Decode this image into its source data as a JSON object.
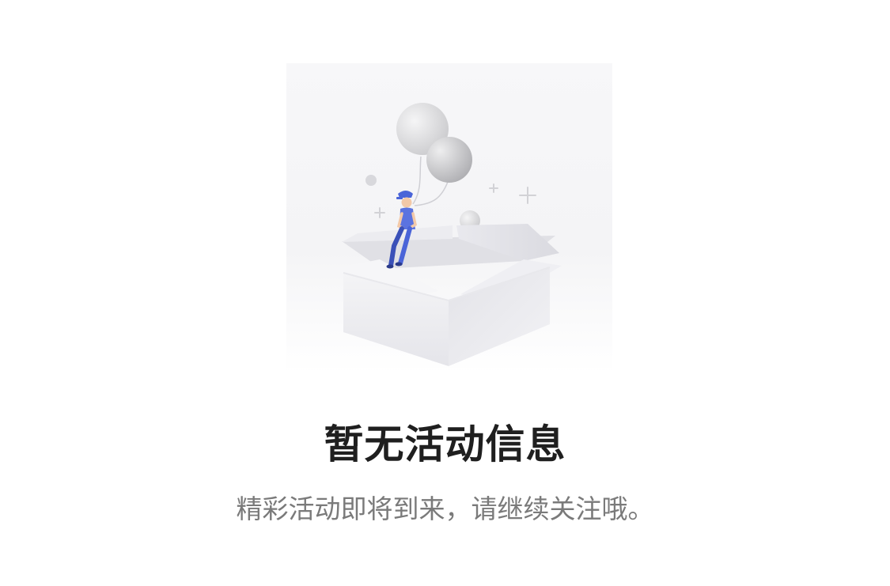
{
  "empty_state": {
    "title": "暂无活动信息",
    "subtitle": "精彩活动即将到来，请继续关注哦。",
    "illustration_icon": "empty-box-with-balloons-icon"
  },
  "colors": {
    "title": "#1f1f1f",
    "subtitle": "#7a7a7a",
    "figure_accent": "#4a64d8",
    "box": "#eeeef1",
    "balloon": "#c9c9cc"
  }
}
